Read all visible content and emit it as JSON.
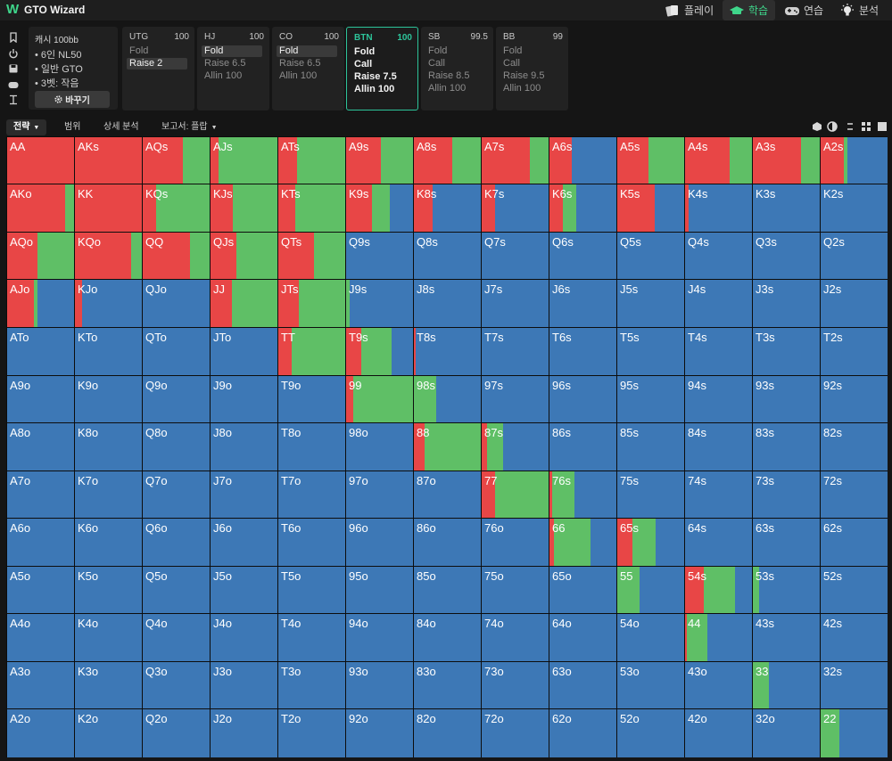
{
  "app": {
    "logo": "W",
    "title": "GTO Wizard"
  },
  "nav": [
    {
      "label": "플레이",
      "icon": "cards-icon",
      "active": false
    },
    {
      "label": "학습",
      "icon": "graduation-cap-icon",
      "active": true
    },
    {
      "label": "연습",
      "icon": "gamepad-icon",
      "active": false
    },
    {
      "label": "분석",
      "icon": "lightbulb-icon",
      "active": false
    }
  ],
  "sidebar_tools": [
    "bookmark-icon",
    "power-icon",
    "save-icon",
    "gamepad-icon",
    "text-cursor-icon"
  ],
  "setup": {
    "title": "캐시  100bb",
    "lines": [
      "6인 NL50",
      "일반 GTO",
      "3벳: 작음"
    ],
    "change_button": "바꾸기"
  },
  "positions": [
    {
      "name": "UTG",
      "stack": "100",
      "active": false,
      "actions": [
        "Fold",
        "Raise 2"
      ],
      "selected": 1
    },
    {
      "name": "HJ",
      "stack": "100",
      "active": false,
      "actions": [
        "Fold",
        "Raise 6.5",
        "Allin 100"
      ],
      "selected": 0
    },
    {
      "name": "CO",
      "stack": "100",
      "active": false,
      "actions": [
        "Fold",
        "Raise 6.5",
        "Allin 100"
      ],
      "selected": 0
    },
    {
      "name": "BTN",
      "stack": "100",
      "active": true,
      "actions": [
        "Fold",
        "Call",
        "Raise 7.5",
        "Allin 100"
      ],
      "selected": -1
    },
    {
      "name": "SB",
      "stack": "99.5",
      "active": false,
      "actions": [
        "Fold",
        "Call",
        "Raise 8.5",
        "Allin 100"
      ],
      "selected": -1
    },
    {
      "name": "BB",
      "stack": "99",
      "active": false,
      "actions": [
        "Fold",
        "Call",
        "Raise 9.5",
        "Allin 100"
      ],
      "selected": -1
    }
  ],
  "tabs": [
    {
      "label": "전략",
      "active": true,
      "dropdown": true
    },
    {
      "label": "범위",
      "active": false,
      "dropdown": false
    },
    {
      "label": "상세 분석",
      "active": false,
      "dropdown": false
    },
    {
      "label": "보고서: 플랍",
      "active": false,
      "dropdown": true
    }
  ],
  "view_icons": [
    "hand-view-icon",
    "contrast-icon",
    "arrows-icon",
    "grid-small-icon",
    "grid-large-icon"
  ],
  "colors": {
    "raise": "#e84646",
    "call": "#5fbf66",
    "fold": "#3d78b6",
    "accent": "#2dc49a"
  },
  "grid": {
    "ranks": [
      "A",
      "K",
      "Q",
      "J",
      "T",
      "9",
      "8",
      "7",
      "6",
      "5",
      "4",
      "3",
      "2"
    ],
    "hands": [
      {
        "hand": "AA",
        "raise": 1.0,
        "call": 0.0
      },
      {
        "hand": "AKs",
        "raise": 1.0,
        "call": 0.0
      },
      {
        "hand": "AQs",
        "raise": 0.6,
        "call": 0.4
      },
      {
        "hand": "AJs",
        "raise": 0.12,
        "call": 0.88
      },
      {
        "hand": "ATs",
        "raise": 0.28,
        "call": 0.72
      },
      {
        "hand": "A9s",
        "raise": 0.52,
        "call": 0.48
      },
      {
        "hand": "A8s",
        "raise": 0.57,
        "call": 0.43
      },
      {
        "hand": "A7s",
        "raise": 0.72,
        "call": 0.28
      },
      {
        "hand": "A6s",
        "raise": 0.33,
        "call": 0.0
      },
      {
        "hand": "A5s",
        "raise": 0.47,
        "call": 0.53
      },
      {
        "hand": "A4s",
        "raise": 0.66,
        "call": 0.34
      },
      {
        "hand": "A3s",
        "raise": 0.72,
        "call": 0.28
      },
      {
        "hand": "A2s",
        "raise": 0.35,
        "call": 0.05
      },
      {
        "hand": "AKo",
        "raise": 0.86,
        "call": 0.14
      },
      {
        "hand": "KK",
        "raise": 1.0,
        "call": 0.0
      },
      {
        "hand": "KQs",
        "raise": 0.2,
        "call": 0.8
      },
      {
        "hand": "KJs",
        "raise": 0.33,
        "call": 0.67
      },
      {
        "hand": "KTs",
        "raise": 0.25,
        "call": 0.75
      },
      {
        "hand": "K9s",
        "raise": 0.38,
        "call": 0.27
      },
      {
        "hand": "K8s",
        "raise": 0.28,
        "call": 0.0
      },
      {
        "hand": "K7s",
        "raise": 0.2,
        "call": 0.0
      },
      {
        "hand": "K6s",
        "raise": 0.2,
        "call": 0.2
      },
      {
        "hand": "K5s",
        "raise": 0.56,
        "call": 0.0
      },
      {
        "hand": "K4s",
        "raise": 0.05,
        "call": 0.0
      },
      {
        "hand": "K3s",
        "raise": 0.0,
        "call": 0.0
      },
      {
        "hand": "K2s",
        "raise": 0.0,
        "call": 0.0
      },
      {
        "hand": "AQo",
        "raise": 0.45,
        "call": 0.55
      },
      {
        "hand": "KQo",
        "raise": 0.84,
        "call": 0.16
      },
      {
        "hand": "QQ",
        "raise": 0.7,
        "call": 0.3
      },
      {
        "hand": "QJs",
        "raise": 0.38,
        "call": 0.62
      },
      {
        "hand": "QTs",
        "raise": 0.53,
        "call": 0.47
      },
      {
        "hand": "Q9s",
        "raise": 0.0,
        "call": 0.0
      },
      {
        "hand": "Q8s",
        "raise": 0.0,
        "call": 0.0
      },
      {
        "hand": "Q7s",
        "raise": 0.0,
        "call": 0.0
      },
      {
        "hand": "Q6s",
        "raise": 0.0,
        "call": 0.0
      },
      {
        "hand": "Q5s",
        "raise": 0.0,
        "call": 0.0
      },
      {
        "hand": "Q4s",
        "raise": 0.0,
        "call": 0.0
      },
      {
        "hand": "Q3s",
        "raise": 0.0,
        "call": 0.0
      },
      {
        "hand": "Q2s",
        "raise": 0.0,
        "call": 0.0
      },
      {
        "hand": "AJo",
        "raise": 0.4,
        "call": 0.05
      },
      {
        "hand": "KJo",
        "raise": 0.1,
        "call": 0.0
      },
      {
        "hand": "QJo",
        "raise": 0.0,
        "call": 0.0
      },
      {
        "hand": "JJ",
        "raise": 0.32,
        "call": 0.68
      },
      {
        "hand": "JTs",
        "raise": 0.3,
        "call": 0.7
      },
      {
        "hand": "J9s",
        "raise": 0.0,
        "call": 0.05
      },
      {
        "hand": "J8s",
        "raise": 0.0,
        "call": 0.0
      },
      {
        "hand": "J7s",
        "raise": 0.0,
        "call": 0.0
      },
      {
        "hand": "J6s",
        "raise": 0.0,
        "call": 0.0
      },
      {
        "hand": "J5s",
        "raise": 0.0,
        "call": 0.0
      },
      {
        "hand": "J4s",
        "raise": 0.0,
        "call": 0.0
      },
      {
        "hand": "J3s",
        "raise": 0.0,
        "call": 0.0
      },
      {
        "hand": "J2s",
        "raise": 0.0,
        "call": 0.0
      },
      {
        "hand": "ATo",
        "raise": 0.0,
        "call": 0.0
      },
      {
        "hand": "KTo",
        "raise": 0.0,
        "call": 0.0
      },
      {
        "hand": "QTo",
        "raise": 0.0,
        "call": 0.0
      },
      {
        "hand": "JTo",
        "raise": 0.0,
        "call": 0.0
      },
      {
        "hand": "TT",
        "raise": 0.2,
        "call": 0.8
      },
      {
        "hand": "T9s",
        "raise": 0.22,
        "call": 0.45
      },
      {
        "hand": "T8s",
        "raise": 0.03,
        "call": 0.0
      },
      {
        "hand": "T7s",
        "raise": 0.0,
        "call": 0.0
      },
      {
        "hand": "T6s",
        "raise": 0.0,
        "call": 0.0
      },
      {
        "hand": "T5s",
        "raise": 0.0,
        "call": 0.0
      },
      {
        "hand": "T4s",
        "raise": 0.0,
        "call": 0.0
      },
      {
        "hand": "T3s",
        "raise": 0.0,
        "call": 0.0
      },
      {
        "hand": "T2s",
        "raise": 0.0,
        "call": 0.0
      },
      {
        "hand": "A9o",
        "raise": 0.0,
        "call": 0.0
      },
      {
        "hand": "K9o",
        "raise": 0.0,
        "call": 0.0
      },
      {
        "hand": "Q9o",
        "raise": 0.0,
        "call": 0.0
      },
      {
        "hand": "J9o",
        "raise": 0.0,
        "call": 0.0
      },
      {
        "hand": "T9o",
        "raise": 0.0,
        "call": 0.0
      },
      {
        "hand": "99",
        "raise": 0.1,
        "call": 0.9
      },
      {
        "hand": "98s",
        "raise": 0.0,
        "call": 0.33
      },
      {
        "hand": "97s",
        "raise": 0.0,
        "call": 0.0
      },
      {
        "hand": "96s",
        "raise": 0.0,
        "call": 0.0
      },
      {
        "hand": "95s",
        "raise": 0.0,
        "call": 0.0
      },
      {
        "hand": "94s",
        "raise": 0.0,
        "call": 0.0
      },
      {
        "hand": "93s",
        "raise": 0.0,
        "call": 0.0
      },
      {
        "hand": "92s",
        "raise": 0.0,
        "call": 0.0
      },
      {
        "hand": "A8o",
        "raise": 0.0,
        "call": 0.0
      },
      {
        "hand": "K8o",
        "raise": 0.0,
        "call": 0.0
      },
      {
        "hand": "Q8o",
        "raise": 0.0,
        "call": 0.0
      },
      {
        "hand": "J8o",
        "raise": 0.0,
        "call": 0.0
      },
      {
        "hand": "T8o",
        "raise": 0.0,
        "call": 0.0
      },
      {
        "hand": "98o",
        "raise": 0.0,
        "call": 0.0
      },
      {
        "hand": "88",
        "raise": 0.16,
        "call": 0.84
      },
      {
        "hand": "87s",
        "raise": 0.08,
        "call": 0.24
      },
      {
        "hand": "86s",
        "raise": 0.0,
        "call": 0.0
      },
      {
        "hand": "85s",
        "raise": 0.0,
        "call": 0.0
      },
      {
        "hand": "84s",
        "raise": 0.0,
        "call": 0.0
      },
      {
        "hand": "83s",
        "raise": 0.0,
        "call": 0.0
      },
      {
        "hand": "82s",
        "raise": 0.0,
        "call": 0.0
      },
      {
        "hand": "A7o",
        "raise": 0.0,
        "call": 0.0
      },
      {
        "hand": "K7o",
        "raise": 0.0,
        "call": 0.0
      },
      {
        "hand": "Q7o",
        "raise": 0.0,
        "call": 0.0
      },
      {
        "hand": "J7o",
        "raise": 0.0,
        "call": 0.0
      },
      {
        "hand": "T7o",
        "raise": 0.0,
        "call": 0.0
      },
      {
        "hand": "97o",
        "raise": 0.0,
        "call": 0.0
      },
      {
        "hand": "87o",
        "raise": 0.0,
        "call": 0.0
      },
      {
        "hand": "77",
        "raise": 0.2,
        "call": 0.8
      },
      {
        "hand": "76s",
        "raise": 0.04,
        "call": 0.33
      },
      {
        "hand": "75s",
        "raise": 0.0,
        "call": 0.0
      },
      {
        "hand": "74s",
        "raise": 0.0,
        "call": 0.0
      },
      {
        "hand": "73s",
        "raise": 0.0,
        "call": 0.0
      },
      {
        "hand": "72s",
        "raise": 0.0,
        "call": 0.0
      },
      {
        "hand": "A6o",
        "raise": 0.0,
        "call": 0.0
      },
      {
        "hand": "K6o",
        "raise": 0.0,
        "call": 0.0
      },
      {
        "hand": "Q6o",
        "raise": 0.0,
        "call": 0.0
      },
      {
        "hand": "J6o",
        "raise": 0.0,
        "call": 0.0
      },
      {
        "hand": "T6o",
        "raise": 0.0,
        "call": 0.0
      },
      {
        "hand": "96o",
        "raise": 0.0,
        "call": 0.0
      },
      {
        "hand": "86o",
        "raise": 0.0,
        "call": 0.0
      },
      {
        "hand": "76o",
        "raise": 0.0,
        "call": 0.0
      },
      {
        "hand": "66",
        "raise": 0.06,
        "call": 0.54
      },
      {
        "hand": "65s",
        "raise": 0.22,
        "call": 0.35
      },
      {
        "hand": "64s",
        "raise": 0.0,
        "call": 0.0
      },
      {
        "hand": "63s",
        "raise": 0.0,
        "call": 0.0
      },
      {
        "hand": "62s",
        "raise": 0.0,
        "call": 0.0
      },
      {
        "hand": "A5o",
        "raise": 0.0,
        "call": 0.0
      },
      {
        "hand": "K5o",
        "raise": 0.0,
        "call": 0.0
      },
      {
        "hand": "Q5o",
        "raise": 0.0,
        "call": 0.0
      },
      {
        "hand": "J5o",
        "raise": 0.0,
        "call": 0.0
      },
      {
        "hand": "T5o",
        "raise": 0.0,
        "call": 0.0
      },
      {
        "hand": "95o",
        "raise": 0.0,
        "call": 0.0
      },
      {
        "hand": "85o",
        "raise": 0.0,
        "call": 0.0
      },
      {
        "hand": "75o",
        "raise": 0.0,
        "call": 0.0
      },
      {
        "hand": "65o",
        "raise": 0.0,
        "call": 0.0
      },
      {
        "hand": "55",
        "raise": 0.0,
        "call": 0.33
      },
      {
        "hand": "54s",
        "raise": 0.28,
        "call": 0.47
      },
      {
        "hand": "53s",
        "raise": 0.0,
        "call": 0.09
      },
      {
        "hand": "52s",
        "raise": 0.0,
        "call": 0.0
      },
      {
        "hand": "A4o",
        "raise": 0.0,
        "call": 0.0
      },
      {
        "hand": "K4o",
        "raise": 0.0,
        "call": 0.0
      },
      {
        "hand": "Q4o",
        "raise": 0.0,
        "call": 0.0
      },
      {
        "hand": "J4o",
        "raise": 0.0,
        "call": 0.0
      },
      {
        "hand": "T4o",
        "raise": 0.0,
        "call": 0.0
      },
      {
        "hand": "94o",
        "raise": 0.0,
        "call": 0.0
      },
      {
        "hand": "84o",
        "raise": 0.0,
        "call": 0.0
      },
      {
        "hand": "74o",
        "raise": 0.0,
        "call": 0.0
      },
      {
        "hand": "64o",
        "raise": 0.0,
        "call": 0.0
      },
      {
        "hand": "54o",
        "raise": 0.0,
        "call": 0.0
      },
      {
        "hand": "44",
        "raise": 0.03,
        "call": 0.3
      },
      {
        "hand": "43s",
        "raise": 0.0,
        "call": 0.0
      },
      {
        "hand": "42s",
        "raise": 0.0,
        "call": 0.0
      },
      {
        "hand": "A3o",
        "raise": 0.0,
        "call": 0.0
      },
      {
        "hand": "K3o",
        "raise": 0.0,
        "call": 0.0
      },
      {
        "hand": "Q3o",
        "raise": 0.0,
        "call": 0.0
      },
      {
        "hand": "J3o",
        "raise": 0.0,
        "call": 0.0
      },
      {
        "hand": "T3o",
        "raise": 0.0,
        "call": 0.0
      },
      {
        "hand": "93o",
        "raise": 0.0,
        "call": 0.0
      },
      {
        "hand": "83o",
        "raise": 0.0,
        "call": 0.0
      },
      {
        "hand": "73o",
        "raise": 0.0,
        "call": 0.0
      },
      {
        "hand": "63o",
        "raise": 0.0,
        "call": 0.0
      },
      {
        "hand": "53o",
        "raise": 0.0,
        "call": 0.0
      },
      {
        "hand": "43o",
        "raise": 0.0,
        "call": 0.0
      },
      {
        "hand": "33",
        "raise": 0.0,
        "call": 0.24
      },
      {
        "hand": "32s",
        "raise": 0.0,
        "call": 0.0
      },
      {
        "hand": "A2o",
        "raise": 0.0,
        "call": 0.0
      },
      {
        "hand": "K2o",
        "raise": 0.0,
        "call": 0.0
      },
      {
        "hand": "Q2o",
        "raise": 0.0,
        "call": 0.0
      },
      {
        "hand": "J2o",
        "raise": 0.0,
        "call": 0.0
      },
      {
        "hand": "T2o",
        "raise": 0.0,
        "call": 0.0
      },
      {
        "hand": "92o",
        "raise": 0.0,
        "call": 0.0
      },
      {
        "hand": "82o",
        "raise": 0.0,
        "call": 0.0
      },
      {
        "hand": "72o",
        "raise": 0.0,
        "call": 0.0
      },
      {
        "hand": "62o",
        "raise": 0.0,
        "call": 0.0
      },
      {
        "hand": "52o",
        "raise": 0.0,
        "call": 0.0
      },
      {
        "hand": "42o",
        "raise": 0.0,
        "call": 0.0
      },
      {
        "hand": "32o",
        "raise": 0.0,
        "call": 0.0
      },
      {
        "hand": "22",
        "raise": 0.0,
        "call": 0.28
      }
    ]
  }
}
